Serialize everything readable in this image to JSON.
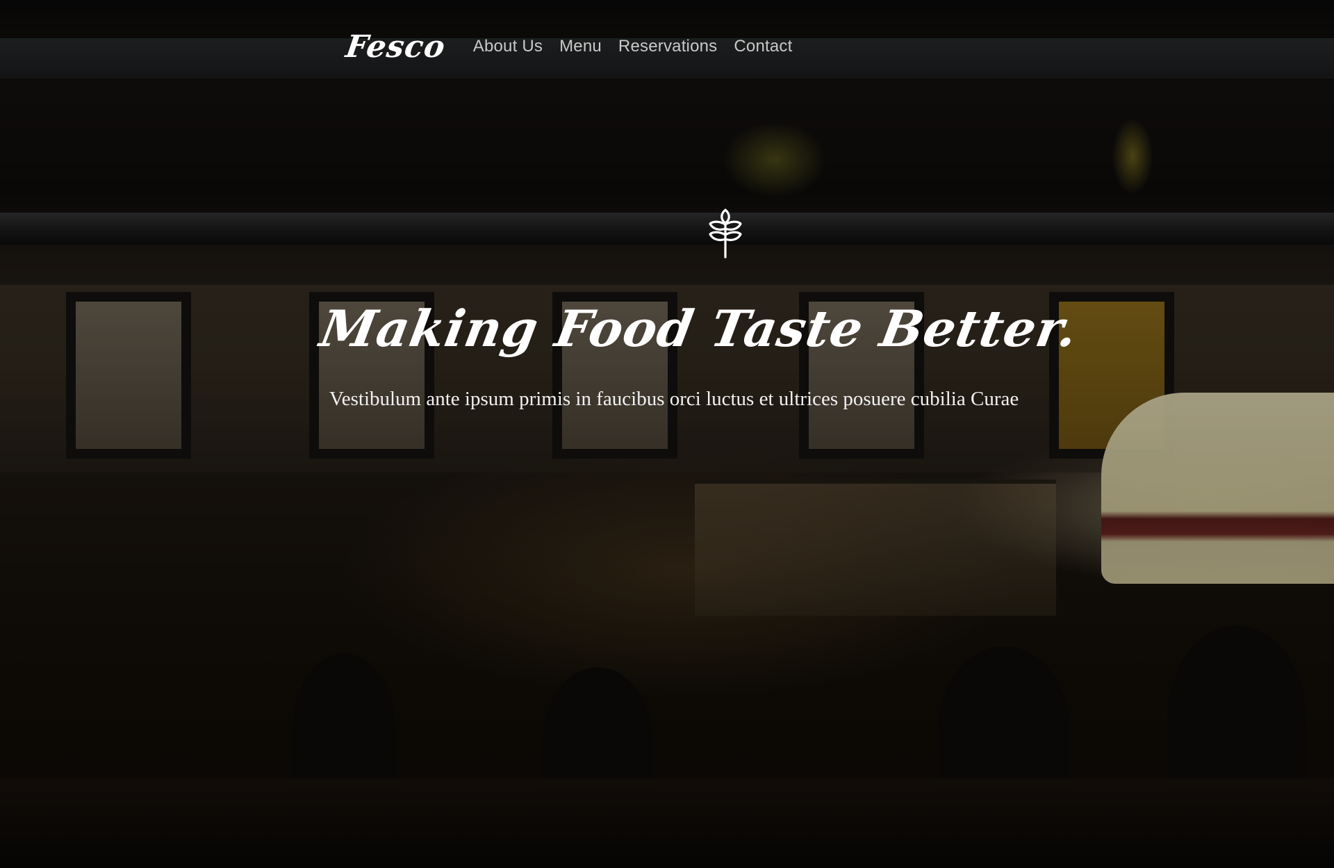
{
  "nav": {
    "logo": "Fesco",
    "links": [
      "About Us",
      "Menu",
      "Reservations",
      "Contact"
    ]
  },
  "hero": {
    "emblem_icon": "wheat-icon",
    "title": "Making Food Taste Better.",
    "subtitle": "Vestibulum ante ipsum primis in faucibus orci luctus et ultrices posuere cubilia Curae",
    "background_image": "dark restaurant bar interior"
  },
  "colors": {
    "text_primary": "#ffffff",
    "nav_link": "#c9c9c9",
    "background_dark": "#0c0907"
  }
}
